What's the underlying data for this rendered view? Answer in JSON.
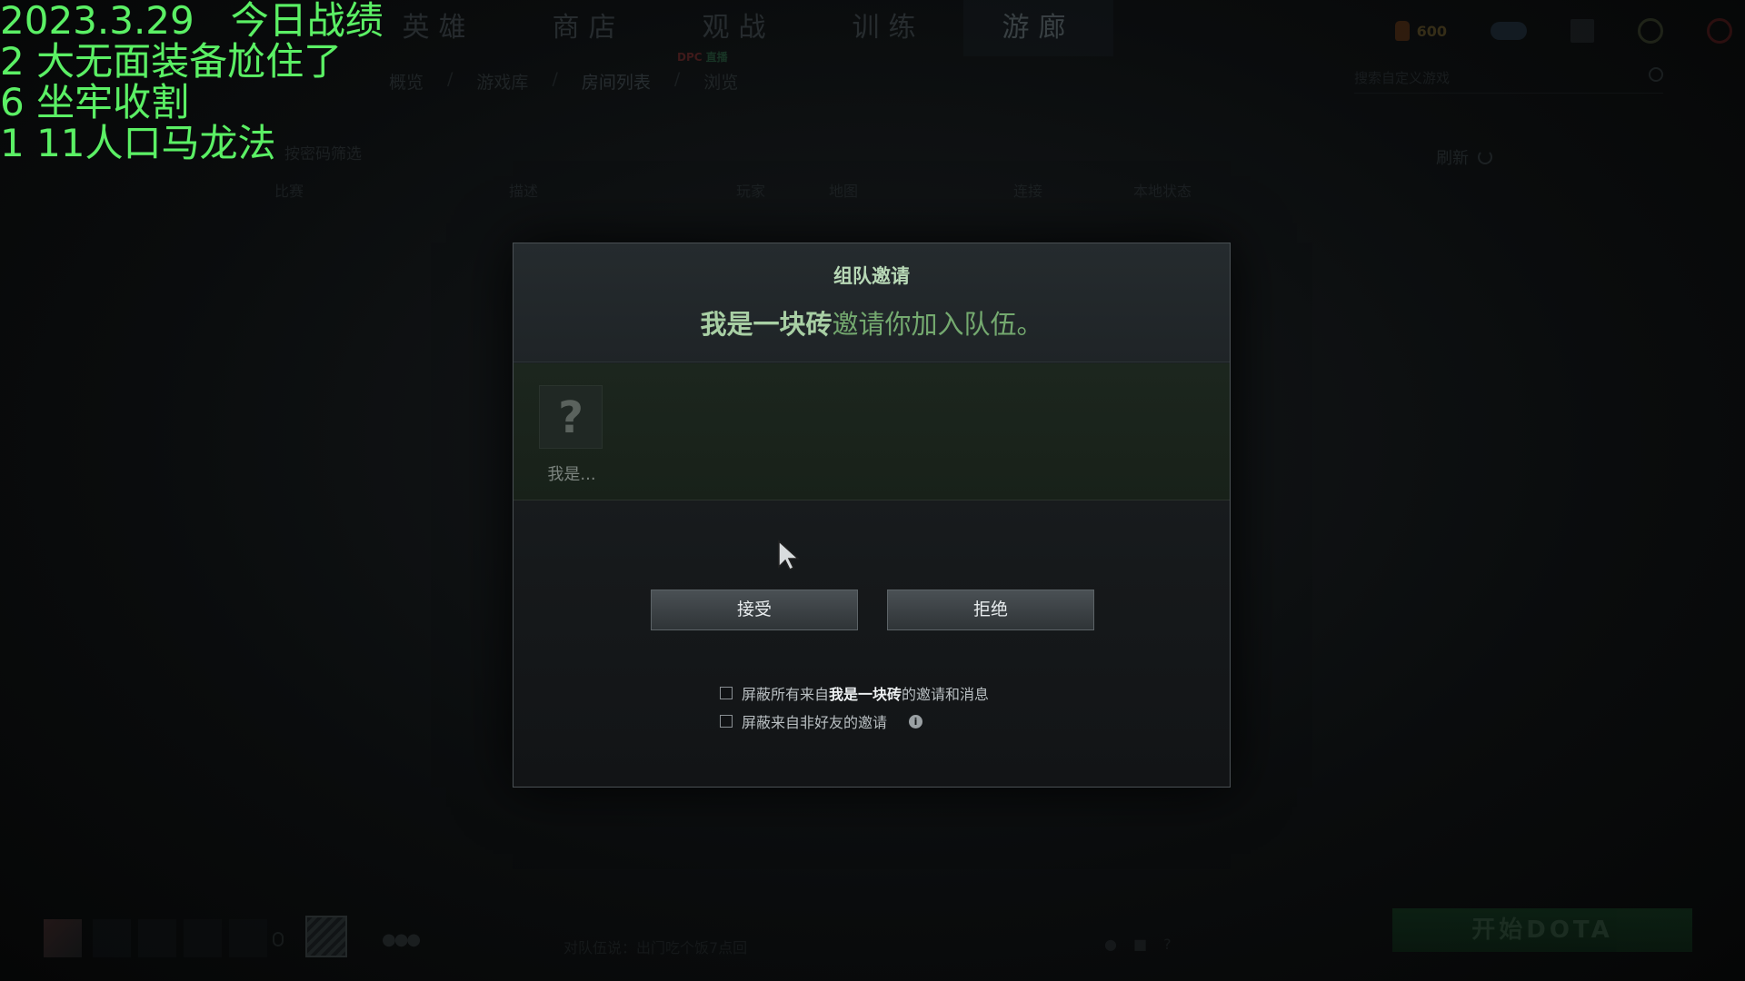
{
  "nav": {
    "tabs": [
      {
        "label": "英雄"
      },
      {
        "label": "商店"
      },
      {
        "label": "观战"
      },
      {
        "label": "训练"
      },
      {
        "label": "游廊"
      }
    ],
    "dpc_badge": "DPC",
    "dpc_live": "直播"
  },
  "breadcrumb": {
    "items": [
      "概览",
      "游戏库",
      "房间列表",
      "浏览"
    ],
    "separator": "/"
  },
  "top_right": {
    "shards": "600"
  },
  "search": {
    "placeholder": "搜索自定义游戏"
  },
  "refresh_label": "刷新",
  "filter_label": "按密码筛选",
  "table_headers": [
    "比赛",
    "描述",
    "玩家",
    "地图",
    "连接",
    "本地状态"
  ],
  "bottom_bar": {
    "chat_line": "对队伍说：出门吃个饭7点回",
    "play_button": "开始DOTA"
  },
  "overlay_notes": [
    "2023.3.29   今日战绩",
    "2 大无面装备尬住了",
    "6 坐牢收割",
    "1 11人口马龙法"
  ],
  "dialog": {
    "title": "组队邀请",
    "inviter": "我是一块砖",
    "message_tail": "邀请你加入队伍。",
    "member": {
      "icon_glyph": "?",
      "name": "我是..."
    },
    "accept_label": "接受",
    "decline_label": "拒绝",
    "option1_prefix": "屏蔽所有来自",
    "option1_name": "我是一块砖",
    "option1_suffix": "的邀请和消息",
    "option2_label": "屏蔽来自非好友的邀请",
    "info_glyph": "i"
  },
  "colors": {
    "overlay_text": "#5bf065",
    "dialog_title": "#b8d8b6",
    "inviter": "#a8cfa4",
    "message": "#74a96f",
    "play_button": "#10321b"
  }
}
